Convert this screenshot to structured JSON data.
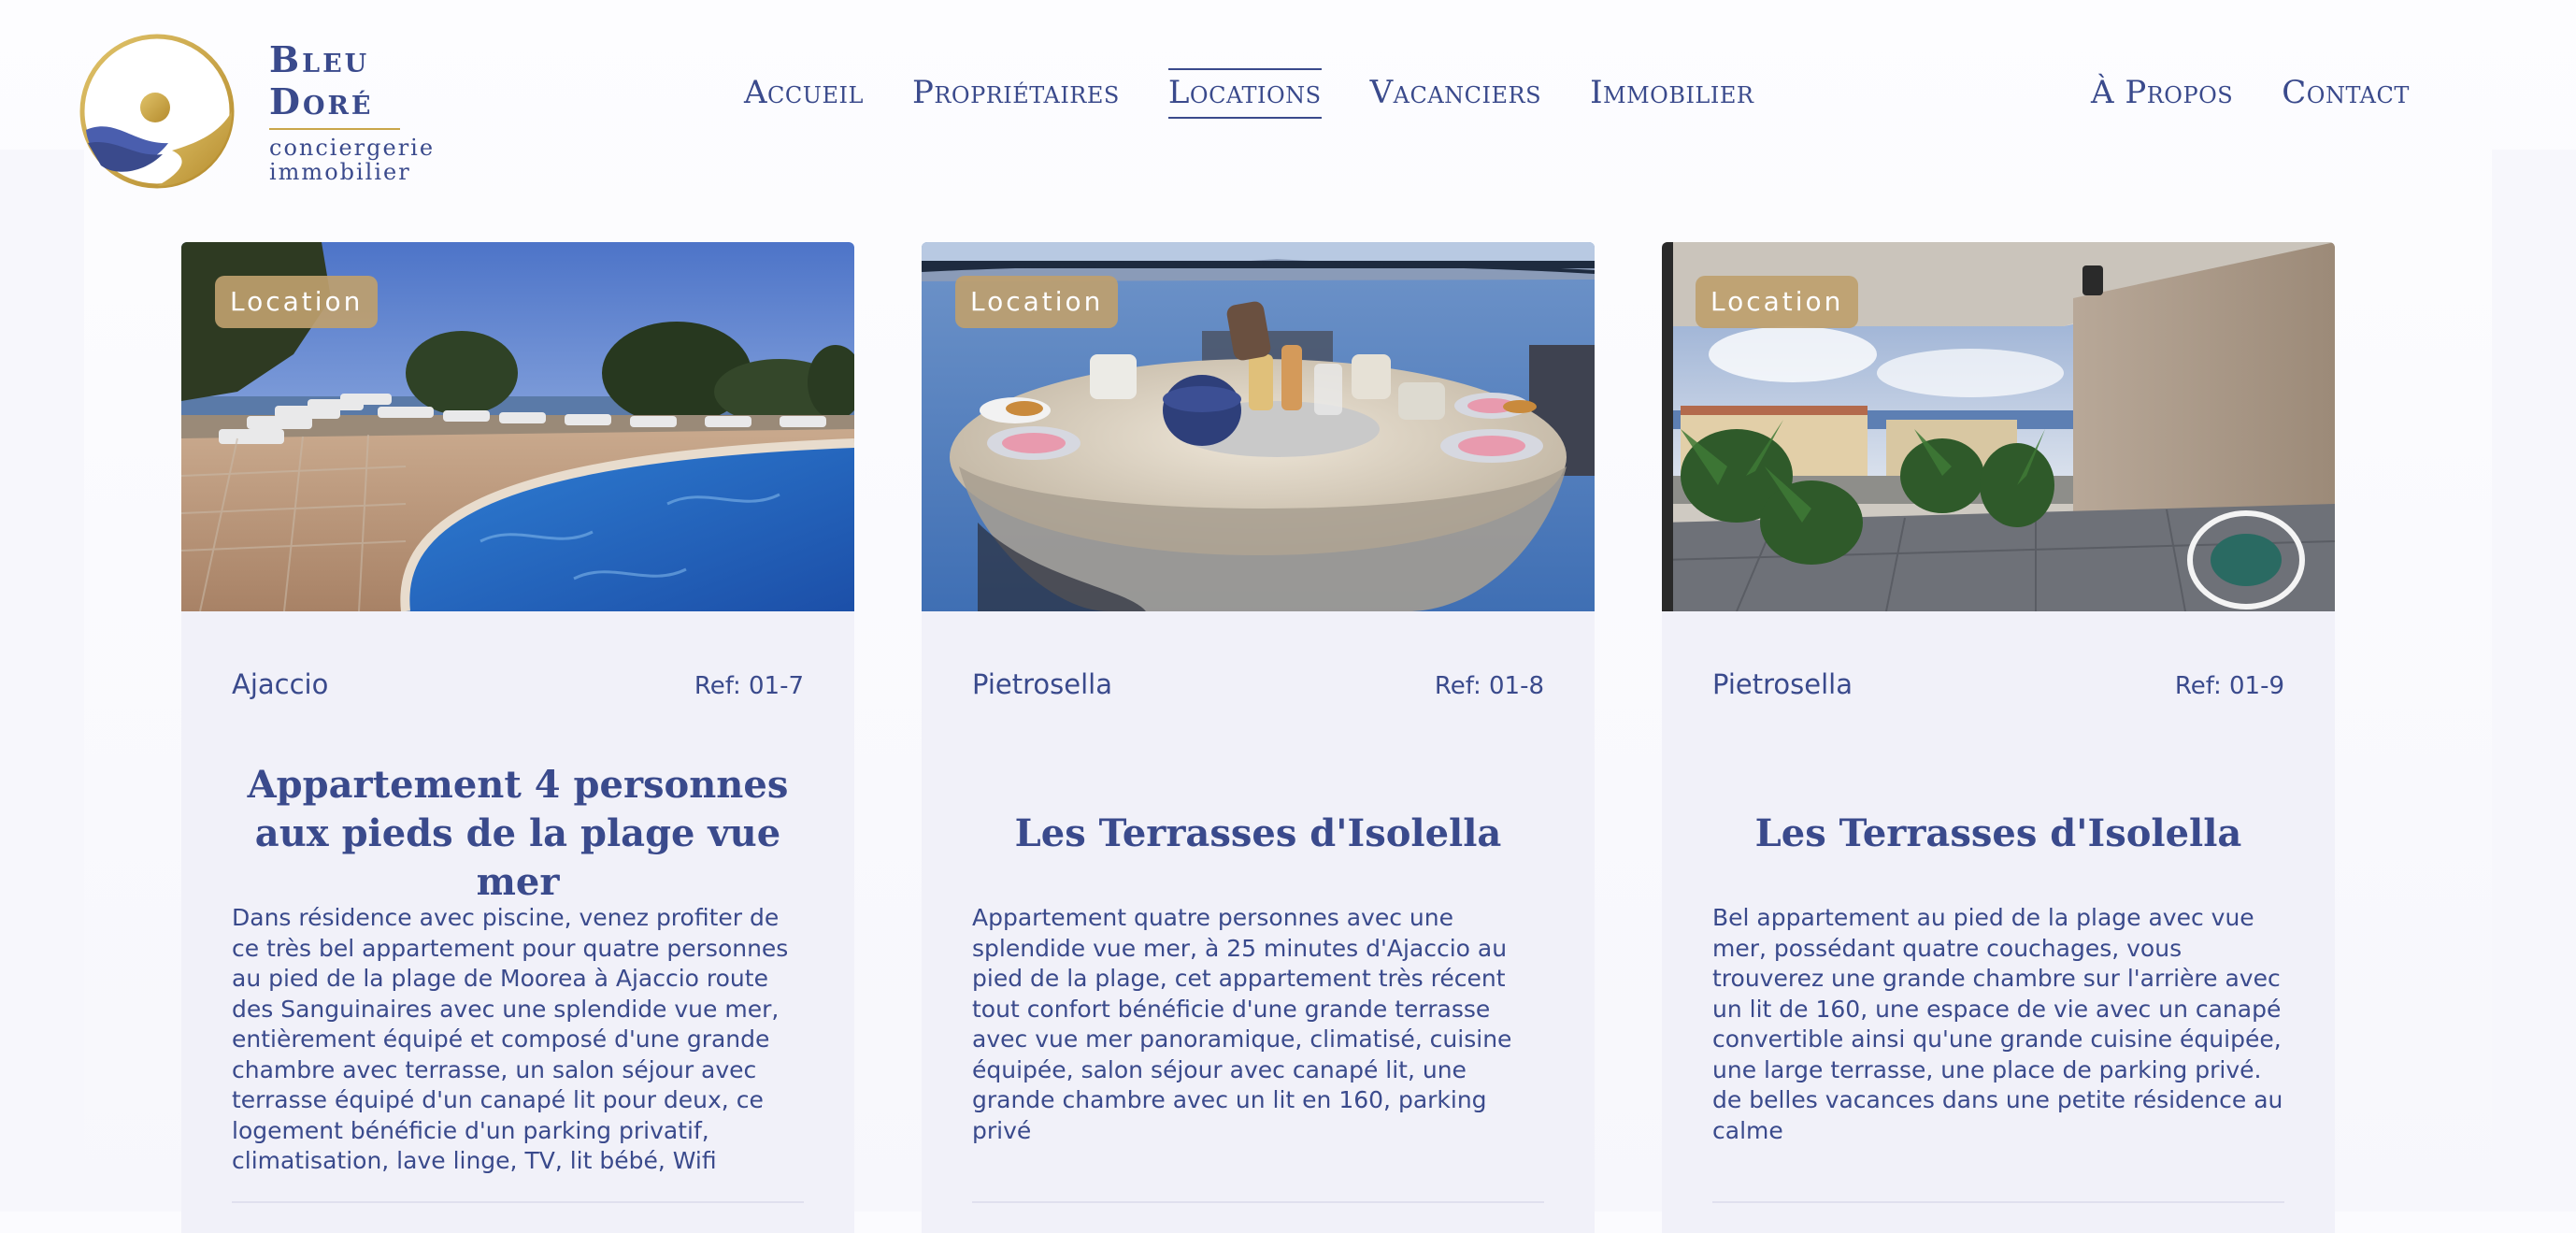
{
  "brand": {
    "name": "Bleu Doré",
    "subtitle_line1": "conciergerie",
    "subtitle_line2": "immobilier"
  },
  "nav": {
    "main": [
      "Accueil",
      "Propriétaires",
      "Locations",
      "Vacanciers",
      "Immobilier"
    ],
    "secondary": [
      "À Propos",
      "Contact"
    ],
    "active": "Locations"
  },
  "colors": {
    "brand_blue": "#3a4a8c",
    "gold": "#c9a64a",
    "badge": "#bea06e",
    "card_bg": "#f1f1f9"
  },
  "listings": [
    {
      "badge": "Location",
      "city": "Ajaccio",
      "ref": "Ref: 01-7",
      "title": "Appartement 4 personnes aux pieds de la plage vue mer",
      "description": "Dans résidence avec piscine, venez profiter de ce très bel appartement pour quatre personnes au pied de la plage de Moorea à Ajaccio route des Sanguinaires avec une splendide vue mer, entièrement équipé et composé d'une grande chambre avec terrasse, un salon séjour avec terrasse équipé d'un canapé lit pour deux, ce logement bénéficie d'un parking privatif, climatisation, lave linge, TV, lit bébé, Wifi",
      "image": "pool-sea-view-photo"
    },
    {
      "badge": "Location",
      "city": "Pietrosella",
      "ref": "Ref: 01-8",
      "title": "Les Terrasses d'Isolella",
      "description": "Appartement quatre personnes avec une splendide vue mer, à 25 minutes d'Ajaccio au pied de la plage, cet appartement très récent tout confort bénéficie d'une grande terrasse avec vue mer panoramique, climatisé, cuisine équipée, salon séjour avec canapé lit, une grande chambre avec un lit en 160, parking privé",
      "image": "breakfast-table-sea-view-photo"
    },
    {
      "badge": "Location",
      "city": "Pietrosella",
      "ref": "Ref: 01-9",
      "title": "Les Terrasses d'Isolella",
      "description": "Bel appartement au pied de la plage avec vue mer, possédant quatre couchages, vous trouverez une grande chambre sur l'arrière avec un lit de 160, une espace de vie avec un canapé convertible ainsi qu'une grande cuisine équipée, une large terrasse, une place de parking privé. de belles vacances dans une petite résidence au calme",
      "image": "covered-terrace-plants-photo"
    }
  ]
}
